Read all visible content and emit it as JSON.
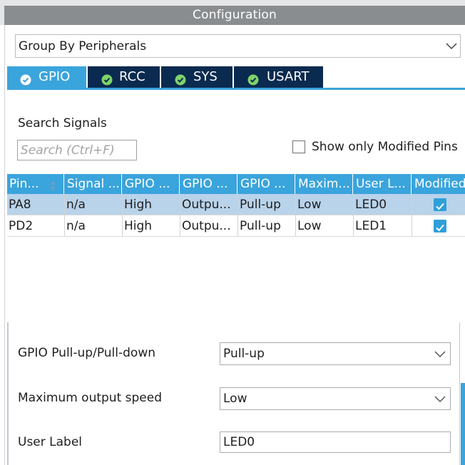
{
  "window": {
    "title": "Configuration"
  },
  "group_select": {
    "value": "Group By Peripherals"
  },
  "tabs": [
    {
      "label": "GPIO",
      "active": true
    },
    {
      "label": "RCC",
      "active": false
    },
    {
      "label": "SYS",
      "active": false
    },
    {
      "label": "USART",
      "active": false
    }
  ],
  "search": {
    "label": "Search Signals",
    "placeholder": "Search (Ctrl+F)",
    "value": ""
  },
  "show_modified": {
    "label": "Show only Modified Pins",
    "checked": false
  },
  "table": {
    "headers": [
      "Pin...",
      "Signal ...",
      "GPIO ...",
      "GPIO ...",
      "GPIO ...",
      "Maxim...",
      "User L...",
      "Modified"
    ],
    "rows": [
      {
        "cells": [
          "PA8",
          "n/a",
          "High",
          "Outpu...",
          "Pull-up",
          "Low",
          "LED0"
        ],
        "modified": true,
        "selected": true
      },
      {
        "cells": [
          "PD2",
          "n/a",
          "High",
          "Outpu...",
          "Pull-up",
          "Low",
          "LED1"
        ],
        "modified": true,
        "selected": false
      }
    ]
  },
  "properties": {
    "pull": {
      "label": "GPIO Pull-up/Pull-down",
      "value": "Pull-up"
    },
    "speed": {
      "label": "Maximum output speed",
      "value": "Low"
    },
    "user_label": {
      "label": "User Label",
      "value": "LED0"
    }
  },
  "icons": {
    "tab_check": "check-circle-icon",
    "dropdown": "chevron-down-icon",
    "sort": "sort-icon",
    "checkbox": "checkbox-checked-icon"
  },
  "colors": {
    "accent": "#3aa4dc",
    "tab_dark": "#0a2a4f",
    "selected_row": "#b9d3ea",
    "title_bar": "#8a8d90"
  }
}
